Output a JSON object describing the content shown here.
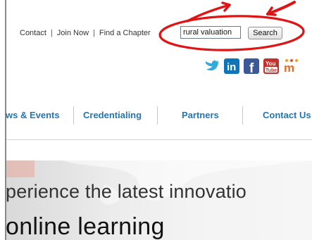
{
  "top_links": {
    "contact": "Contact",
    "separator": "|",
    "join_now": "Join Now",
    "find_chapter": "Find a Chapter"
  },
  "search": {
    "value": "rural valuation",
    "button_label": "Search"
  },
  "social_icons": [
    "twitter-icon",
    "linkedin-icon",
    "facebook-icon",
    "youtube-icon",
    "network-icon"
  ],
  "social_text": {
    "linkedin": "in",
    "facebook": "f",
    "youtube_top": "You",
    "youtube_bottom": "Tube",
    "network": "m"
  },
  "main_nav": {
    "items": [
      "ws & Events",
      "Credentialing",
      "Partners",
      "Contact Us"
    ]
  },
  "hero": {
    "line1": "perience the latest innovatio",
    "line2": "online learning"
  },
  "colors": {
    "nav_link": "#2475b4",
    "annotation": "#e01414",
    "linkedin": "#0e76b7",
    "facebook": "#3b5998",
    "youtube": "#c4302b"
  }
}
